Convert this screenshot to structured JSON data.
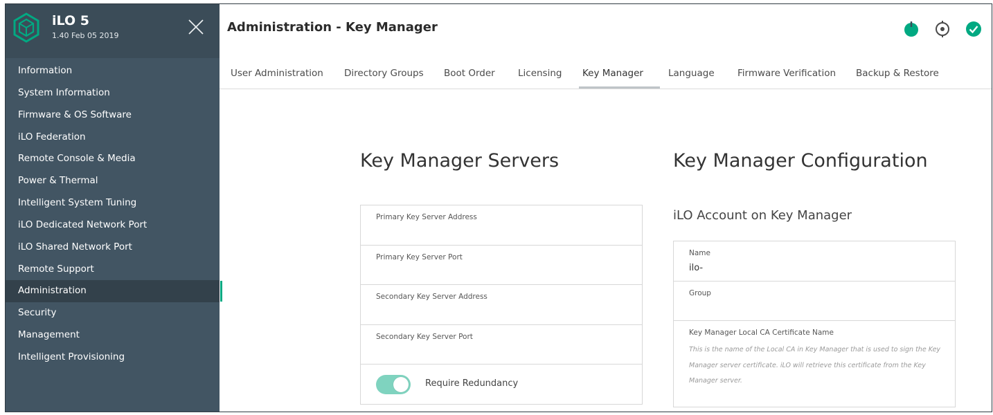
{
  "brand": {
    "name": "iLO 5",
    "version": "1.40 Feb 05 2019",
    "accent_color": "#01a982"
  },
  "sidebar": {
    "items": [
      {
        "label": "Information"
      },
      {
        "label": "System Information"
      },
      {
        "label": "Firmware & OS Software"
      },
      {
        "label": "iLO Federation"
      },
      {
        "label": "Remote Console & Media"
      },
      {
        "label": "Power & Thermal"
      },
      {
        "label": "Intelligent System Tuning"
      },
      {
        "label": "iLO Dedicated Network Port"
      },
      {
        "label": "iLO Shared Network Port"
      },
      {
        "label": "Remote Support"
      },
      {
        "label": "Administration"
      },
      {
        "label": "Security"
      },
      {
        "label": "Management"
      },
      {
        "label": "Intelligent Provisioning"
      }
    ]
  },
  "header": {
    "title": "Administration - Key Manager",
    "icons": [
      "power-icon",
      "locator-icon",
      "health-ok-icon"
    ]
  },
  "tabs": [
    {
      "label": "User Administration"
    },
    {
      "label": "Directory Groups"
    },
    {
      "label": "Boot Order"
    },
    {
      "label": "Licensing"
    },
    {
      "label": "Key Manager"
    },
    {
      "label": "Language"
    },
    {
      "label": "Firmware Verification"
    },
    {
      "label": "Backup & Restore"
    }
  ],
  "servers": {
    "title": "Key Manager Servers",
    "fields": [
      {
        "label": "Primary Key Server Address",
        "value": ""
      },
      {
        "label": "Primary Key Server Port",
        "value": ""
      },
      {
        "label": "Secondary Key Server Address",
        "value": ""
      },
      {
        "label": "Secondary Key Server Port",
        "value": ""
      }
    ],
    "redundancy_label": "Require Redundancy"
  },
  "config": {
    "title": "Key Manager Configuration",
    "account_title": "iLO Account on Key Manager",
    "name_label": "Name",
    "name_value": "ilo-",
    "group_label": "Group",
    "group_value": "",
    "ca_label": "Key Manager Local CA Certificate Name",
    "ca_help": "This is the name of the Local CA in Key Manager that is used to sign the Key Manager server certificate. iLO will retrieve this certificate from the Key Manager server."
  }
}
